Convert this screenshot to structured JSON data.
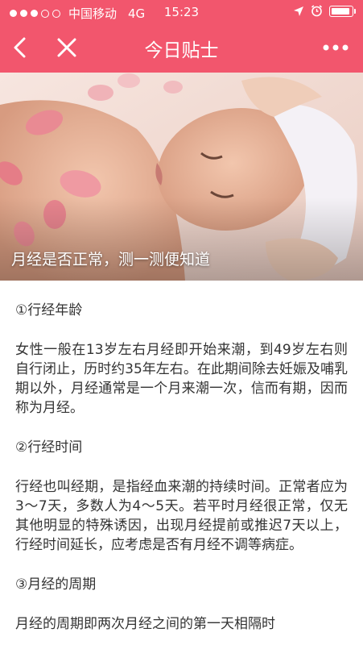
{
  "status_bar": {
    "carrier": "中国移动",
    "network": "4G",
    "time": "15:23"
  },
  "nav": {
    "title": "今日贴士"
  },
  "colors": {
    "header": "#f2566d",
    "text": "#333333"
  },
  "hero": {
    "caption": "月经是否正常，测一测便知道"
  },
  "article": {
    "sections": [
      {
        "heading": "①行经年龄",
        "body": "女性一般在13岁左右月经即开始来潮，到49岁左右则自行闭止，历时约35年左右。在此期间除去妊娠及哺乳期以外，月经通常是一个月来潮一次，信而有期，因而称为月经。"
      },
      {
        "heading": "②行经时间",
        "body": "行经也叫经期，是指经血来潮的持续时间。正常者应为3～7天，多数人为4～5天。若平时月经很正常，仅无其他明显的特殊诱因，出现月经提前或推迟7天以上，行经时间延长，应考虑是否有月经不调等病症。"
      },
      {
        "heading": "③月经的周期",
        "body": "月经的周期即两次月经之间的第一天相隔时"
      }
    ]
  }
}
